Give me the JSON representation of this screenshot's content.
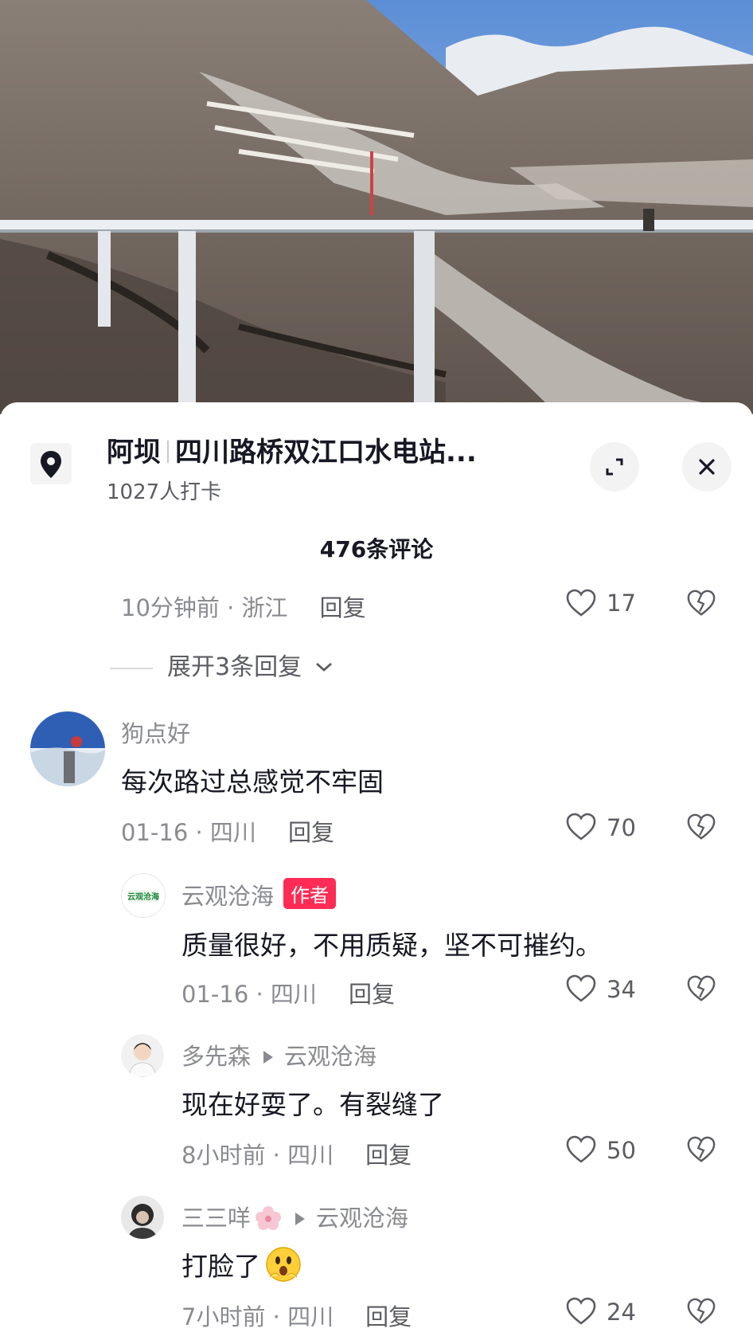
{
  "location": {
    "city": "阿坝",
    "name": "四川路桥双江口水电站...",
    "checkins": "1027人打卡"
  },
  "comment_count": "476条评论",
  "top_comment_meta": {
    "time_region": "10分钟前 · 浙江",
    "reply_label": "回复",
    "likes": "17"
  },
  "expand_label": "展开3条回复",
  "comments": [
    {
      "user": "狗点好",
      "text": "每次路过总感觉不牢固",
      "time_region": "01-16 · 四川",
      "reply_label": "回复",
      "likes": "70"
    },
    {
      "user": "云观沧海",
      "badge": "作者",
      "avatar_text": "云观沧海",
      "text": "质量很好，不用质疑，坚不可摧约。",
      "time_region": "01-16 · 四川",
      "reply_label": "回复",
      "likes": "34"
    },
    {
      "user": "多先森",
      "reply_to": "云观沧海",
      "text": "现在好耍了。有裂缝了",
      "time_region": "8小时前 · 四川",
      "reply_label": "回复",
      "likes": "50"
    },
    {
      "user": "三三咩",
      "reply_to": "云观沧海",
      "text": "打脸了",
      "time_region": "7小时前 · 四川",
      "reply_label": "回复",
      "likes": "24"
    }
  ],
  "colors": {
    "badge": "#fe2c55",
    "text": "#161823",
    "muted": "#8a8b91"
  }
}
